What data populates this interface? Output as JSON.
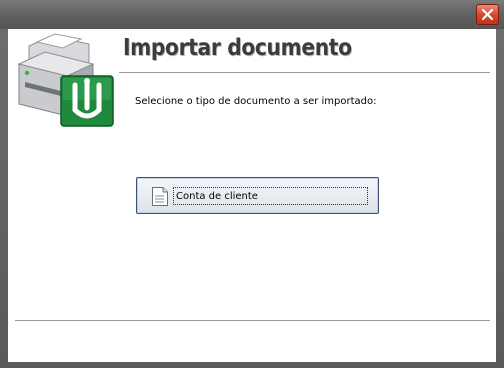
{
  "window": {
    "title": "",
    "titlebar_color": "#666666"
  },
  "header": {
    "title": "Importar documento",
    "logo_icon": "printer-document-logo-icon"
  },
  "instruction": "Selecione o tipo de documento a ser importado:",
  "options": [
    {
      "label": "Conta de cliente",
      "icon": "document-icon"
    }
  ],
  "colors": {
    "close_button": "#d8492f",
    "logo_green": "#1f8a3c",
    "button_border": "#3d4f72"
  }
}
